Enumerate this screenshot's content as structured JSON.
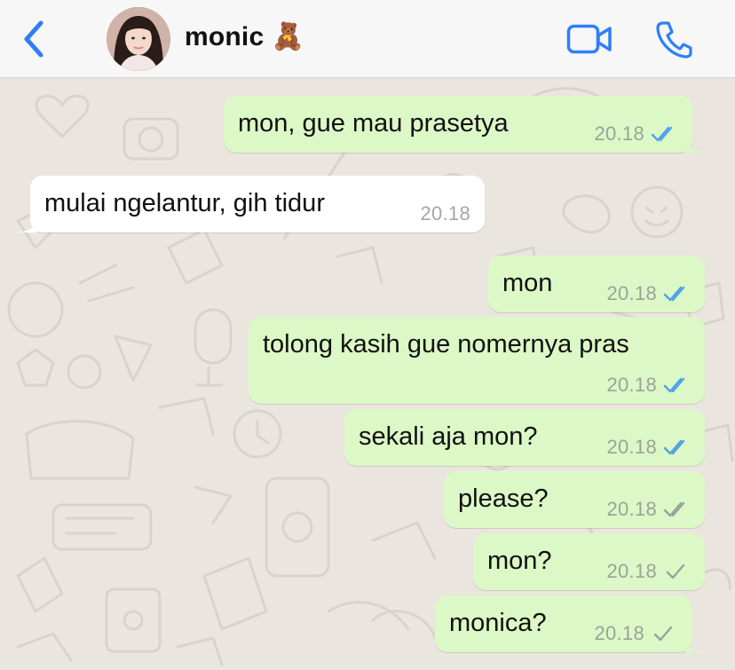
{
  "header": {
    "contact_name": "monic",
    "contact_emoji": "🧸",
    "icons": {
      "back": "chevron-left-icon",
      "video": "video-camera-icon",
      "call": "phone-icon"
    },
    "accent_color": "#2d7ff9"
  },
  "messages": [
    {
      "direction": "out",
      "text": "mon, gue mau prasetya",
      "time": "20.18",
      "status": "read"
    },
    {
      "direction": "in",
      "text": "mulai ngelantur, gih tidur",
      "time": "20.18"
    },
    {
      "direction": "out",
      "text": "mon",
      "time": "20.18",
      "status": "read"
    },
    {
      "direction": "out",
      "text": "tolong kasih gue nomernya pras",
      "time": "20.18",
      "status": "read"
    },
    {
      "direction": "out",
      "text": "sekali aja mon?",
      "time": "20.18",
      "status": "read"
    },
    {
      "direction": "out",
      "text": "please?",
      "time": "20.18",
      "status": "delivered"
    },
    {
      "direction": "out",
      "text": "mon?",
      "time": "20.18",
      "status": "sent"
    },
    {
      "direction": "out",
      "text": "monica?",
      "time": "20.18",
      "status": "sent"
    }
  ],
  "colors": {
    "outgoing_bubble": "#dcf8c6",
    "incoming_bubble": "#ffffff",
    "read_tick": "#4fa3e8",
    "unread_tick": "#9aa39a",
    "chat_background": "#eae6df"
  }
}
